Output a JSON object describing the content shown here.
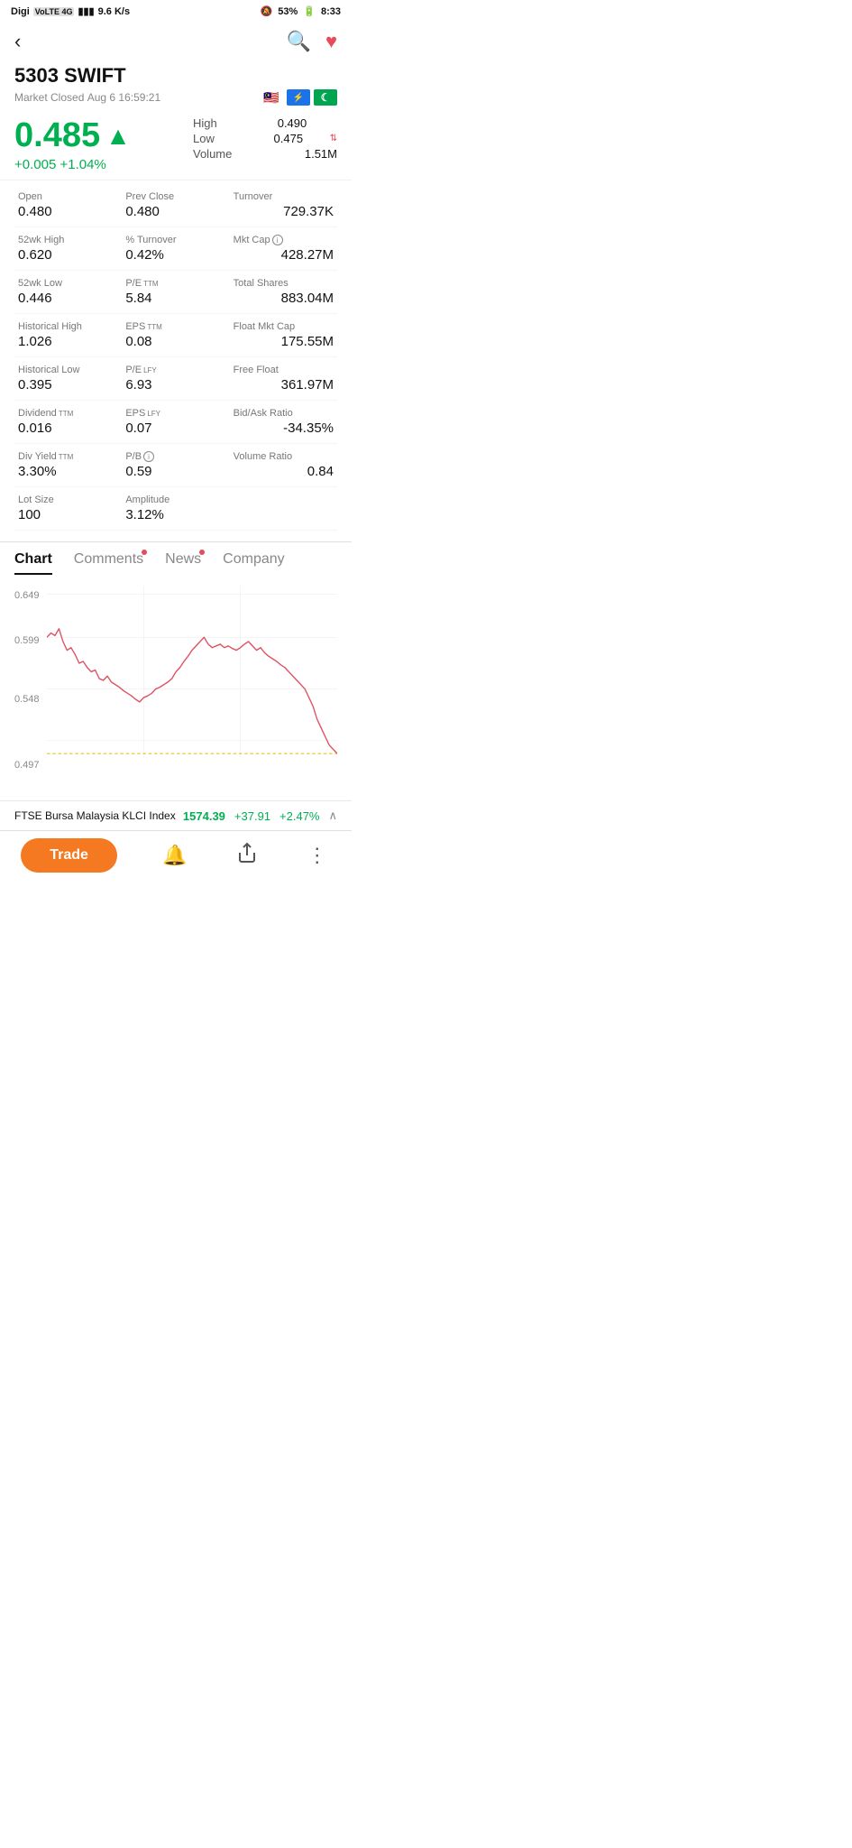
{
  "statusBar": {
    "carrier": "Digi",
    "network": "VoLTE 4G",
    "signal": "9.6 K/s",
    "battery": "53%",
    "time": "8:33"
  },
  "header": {
    "backLabel": "‹",
    "searchLabel": "🔍",
    "heartLabel": "♥"
  },
  "stock": {
    "code": "5303",
    "name": "SWIFT",
    "marketStatus": "Market Closed",
    "datetime": "Aug 6 16:59:21",
    "price": "0.485",
    "priceArrow": "▲",
    "change": "+0.005 +1.04%",
    "high": "0.490",
    "low": "0.475",
    "volume": "1.51M"
  },
  "dataGrid": {
    "open": {
      "label": "Open",
      "value": "0.480"
    },
    "prevClose": {
      "label": "Prev Close",
      "value": "0.480"
    },
    "turnover": {
      "label": "Turnover",
      "value": "729.37K"
    },
    "week52High": {
      "label": "52wk High",
      "value": "0.620"
    },
    "pctTurnover": {
      "label": "% Turnover",
      "value": "0.42%"
    },
    "mktCap": {
      "label": "Mkt Cap",
      "value": "428.27M"
    },
    "week52Low": {
      "label": "52wk Low",
      "value": "0.446"
    },
    "peTTM": {
      "label": "P/E",
      "labelSuper": "TTM",
      "value": "5.84"
    },
    "totalShares": {
      "label": "Total Shares",
      "value": "883.04M"
    },
    "histHigh": {
      "label": "Historical High",
      "value": "1.026"
    },
    "epsTTM": {
      "label": "EPS",
      "labelSuper": "TTM",
      "value": "0.08"
    },
    "floatMktCap": {
      "label": "Float Mkt Cap",
      "value": "175.55M"
    },
    "histLow": {
      "label": "Historical Low",
      "value": "0.395"
    },
    "peLFY": {
      "label": "P/E",
      "labelSuper": "LFY",
      "value": "6.93"
    },
    "freeFloat": {
      "label": "Free Float",
      "value": "361.97M"
    },
    "dividendTTM": {
      "label": "Dividend",
      "labelSuper": "TTM",
      "value": "0.016"
    },
    "epsLFY": {
      "label": "EPS",
      "labelSuper": "LFY",
      "value": "0.07"
    },
    "bidAskRatio": {
      "label": "Bid/Ask Ratio",
      "value": "-34.35%"
    },
    "divYieldTTM": {
      "label": "Div Yield",
      "labelSuper": "TTM",
      "value": "3.30%"
    },
    "pb": {
      "label": "P/B",
      "value": "0.59"
    },
    "volumeRatio": {
      "label": "Volume Ratio",
      "value": "0.84"
    },
    "lotSize": {
      "label": "Lot Size",
      "value": "100"
    },
    "amplitude": {
      "label": "Amplitude",
      "value": "3.12%"
    }
  },
  "tabs": [
    {
      "id": "chart",
      "label": "Chart",
      "active": true,
      "dot": false
    },
    {
      "id": "comments",
      "label": "Comments",
      "active": false,
      "dot": true
    },
    {
      "id": "news",
      "label": "News",
      "active": false,
      "dot": true
    },
    {
      "id": "company",
      "label": "Company",
      "active": false,
      "dot": false
    }
  ],
  "chart": {
    "yLabels": [
      "0.649",
      "0.599",
      "0.548",
      "0.497"
    ],
    "dashedValue": "0.497"
  },
  "bottomIndex": {
    "name": "FTSE Bursa Malaysia KLCI Index",
    "price": "1574.39",
    "change": "+37.91",
    "pct": "+2.47%"
  },
  "bottomNav": {
    "tradeLabel": "Trade"
  }
}
